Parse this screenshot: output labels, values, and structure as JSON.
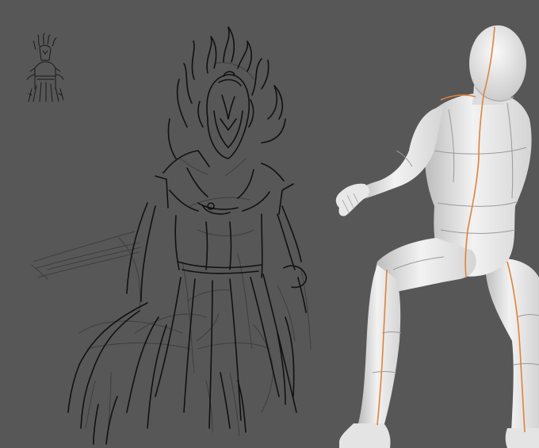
{
  "scene": {
    "background_color": "#575757",
    "line_color_dark": "#141414",
    "line_color_light": "#3a3a3a",
    "mannequin_color": "#ededed",
    "mannequin_shade": "#bdbdbd",
    "guide_line_color": "#e0833a",
    "mesh_line_color": "#9a9a9a"
  },
  "elements": {
    "thumbnail_sketch": "small-knight-thumbnail-icon",
    "main_sketch": "armored-knight-sketch",
    "reference_model": "seated-mannequin-3d"
  }
}
